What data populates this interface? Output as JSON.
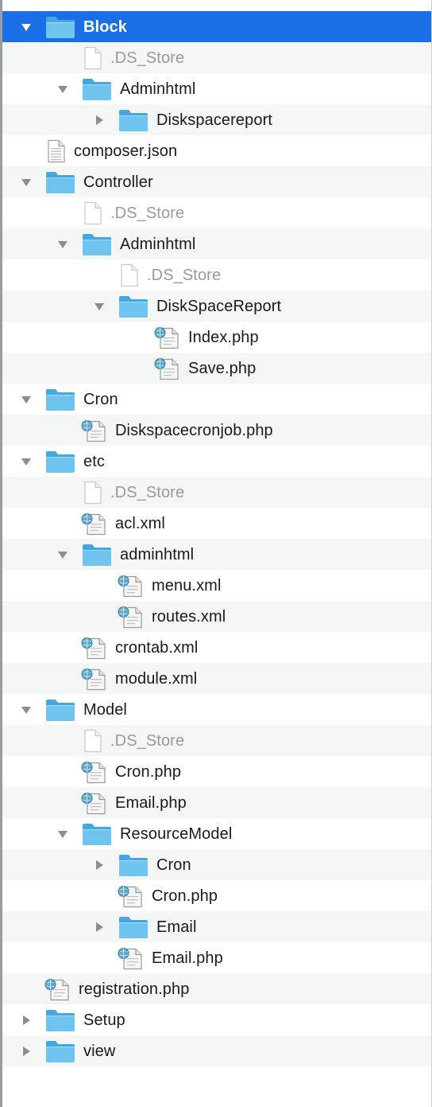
{
  "colors": {
    "selection": "#1a6ee6",
    "folder": "#6fc3ef",
    "folder_dark": "#43a8df",
    "alt_row": "#f4f5f5",
    "dim_text": "#9a9a9a",
    "disclosure": "#8c8c8c"
  },
  "tree": [
    {
      "label": "Block",
      "kind": "folder",
      "depth": 0,
      "expand": "open",
      "selected": true
    },
    {
      "label": ".DS_Store",
      "kind": "blank-file",
      "depth": 1,
      "expand": "none",
      "dim": true
    },
    {
      "label": "Adminhtml",
      "kind": "folder",
      "depth": 1,
      "expand": "open"
    },
    {
      "label": "Diskspacereport",
      "kind": "folder",
      "depth": 2,
      "expand": "closed"
    },
    {
      "label": "composer.json",
      "kind": "text-file",
      "depth": 0,
      "expand": "none"
    },
    {
      "label": "Controller",
      "kind": "folder",
      "depth": 0,
      "expand": "open"
    },
    {
      "label": ".DS_Store",
      "kind": "blank-file",
      "depth": 1,
      "expand": "none",
      "dim": true
    },
    {
      "label": "Adminhtml",
      "kind": "folder",
      "depth": 1,
      "expand": "open"
    },
    {
      "label": ".DS_Store",
      "kind": "blank-file",
      "depth": 2,
      "expand": "none",
      "dim": true
    },
    {
      "label": "DiskSpaceReport",
      "kind": "folder",
      "depth": 2,
      "expand": "open"
    },
    {
      "label": "Index.php",
      "kind": "script-file",
      "depth": 3,
      "expand": "none"
    },
    {
      "label": "Save.php",
      "kind": "script-file",
      "depth": 3,
      "expand": "none"
    },
    {
      "label": "Cron",
      "kind": "folder",
      "depth": 0,
      "expand": "open"
    },
    {
      "label": "Diskspacecronjob.php",
      "kind": "script-file",
      "depth": 1,
      "expand": "none"
    },
    {
      "label": "etc",
      "kind": "folder",
      "depth": 0,
      "expand": "open"
    },
    {
      "label": ".DS_Store",
      "kind": "blank-file",
      "depth": 1,
      "expand": "none",
      "dim": true
    },
    {
      "label": "acl.xml",
      "kind": "script-file",
      "depth": 1,
      "expand": "none"
    },
    {
      "label": "adminhtml",
      "kind": "folder",
      "depth": 1,
      "expand": "open"
    },
    {
      "label": "menu.xml",
      "kind": "script-file",
      "depth": 2,
      "expand": "none"
    },
    {
      "label": "routes.xml",
      "kind": "script-file",
      "depth": 2,
      "expand": "none"
    },
    {
      "label": "crontab.xml",
      "kind": "script-file",
      "depth": 1,
      "expand": "none"
    },
    {
      "label": "module.xml",
      "kind": "script-file",
      "depth": 1,
      "expand": "none"
    },
    {
      "label": "Model",
      "kind": "folder",
      "depth": 0,
      "expand": "open"
    },
    {
      "label": ".DS_Store",
      "kind": "blank-file",
      "depth": 1,
      "expand": "none",
      "dim": true
    },
    {
      "label": "Cron.php",
      "kind": "script-file",
      "depth": 1,
      "expand": "none"
    },
    {
      "label": "Email.php",
      "kind": "script-file",
      "depth": 1,
      "expand": "none"
    },
    {
      "label": "ResourceModel",
      "kind": "folder",
      "depth": 1,
      "expand": "open"
    },
    {
      "label": "Cron",
      "kind": "folder",
      "depth": 2,
      "expand": "closed"
    },
    {
      "label": "Cron.php",
      "kind": "script-file",
      "depth": 2,
      "expand": "none"
    },
    {
      "label": "Email",
      "kind": "folder",
      "depth": 2,
      "expand": "closed"
    },
    {
      "label": "Email.php",
      "kind": "script-file",
      "depth": 2,
      "expand": "none"
    },
    {
      "label": "registration.php",
      "kind": "script-file",
      "depth": 0,
      "expand": "none"
    },
    {
      "label": "Setup",
      "kind": "folder",
      "depth": 0,
      "expand": "closed"
    },
    {
      "label": "view",
      "kind": "folder",
      "depth": 0,
      "expand": "closed"
    }
  ]
}
